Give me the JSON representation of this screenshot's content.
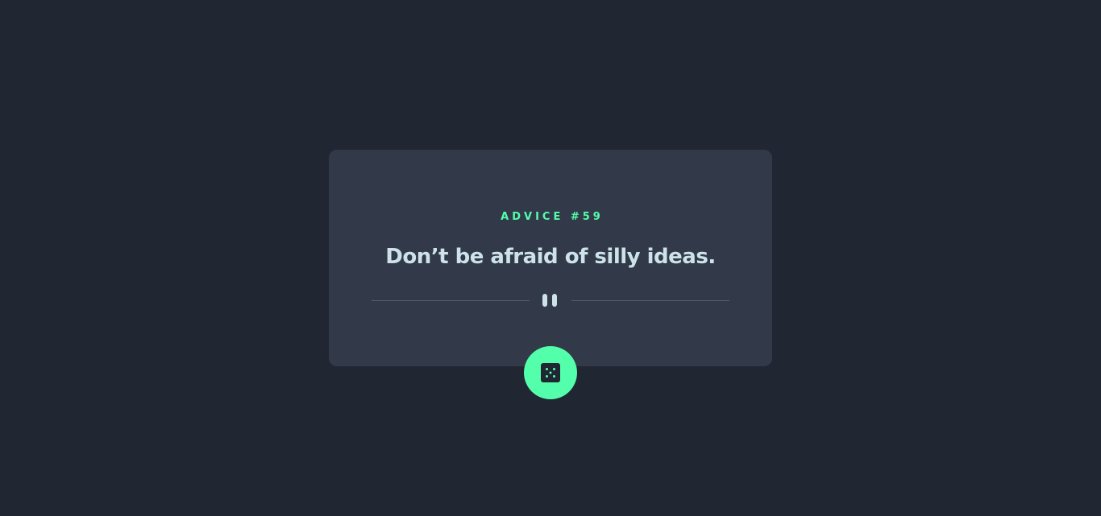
{
  "advice": {
    "label": "ADVICE #59",
    "text": "Don’t be afraid of silly ideas."
  },
  "divider": {
    "icon": "pause-icon"
  },
  "dice_button": {
    "icon": "dice-icon"
  },
  "colors": {
    "background": "#202632",
    "card": "#323a49",
    "accent": "#53ffaa",
    "text": "#cee3e9",
    "divider": "#4f5d74"
  }
}
